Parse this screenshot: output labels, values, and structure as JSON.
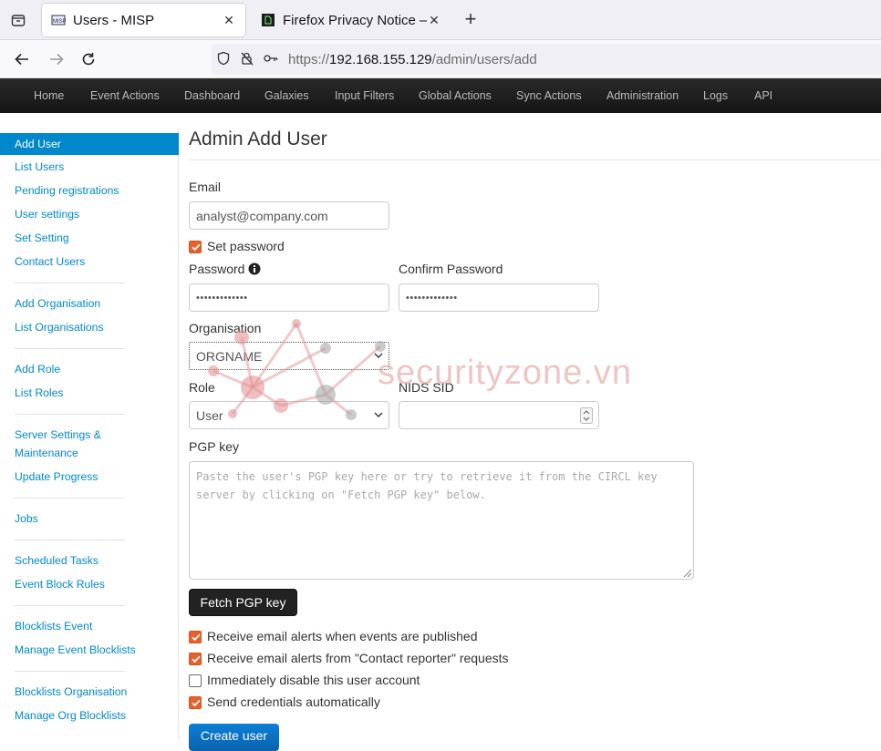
{
  "browser": {
    "tabs": [
      {
        "title": "Users - MISP",
        "active": true
      },
      {
        "title": "Firefox Privacy Notice —",
        "active": false
      }
    ],
    "url_prefix": "https://",
    "url_host": "192.168.155.129",
    "url_path": "/admin/users/add"
  },
  "topnav": [
    "Home",
    "Event Actions",
    "Dashboard",
    "Galaxies",
    "Input Filters",
    "Global Actions",
    "Sync Actions",
    "Administration",
    "Logs",
    "API"
  ],
  "sidebar": {
    "groups": [
      [
        "Add User",
        "List Users",
        "Pending registrations",
        "User settings",
        "Set Setting",
        "Contact Users"
      ],
      [
        "Add Organisation",
        "List Organisations"
      ],
      [
        "Add Role",
        "List Roles"
      ],
      [
        "Server Settings &",
        "Maintenance",
        "Update Progress"
      ],
      [
        "Jobs"
      ],
      [
        "Scheduled Tasks",
        "Event Block Rules"
      ],
      [
        "Blocklists Event",
        "Manage Event Blocklists"
      ],
      [
        "Blocklists Organisation",
        "Manage Org Blocklists"
      ]
    ],
    "active": "Add User"
  },
  "form": {
    "title": "Admin Add User",
    "email_label": "Email",
    "email_value": "analyst@company.com",
    "set_password_label": "Set password",
    "set_password_checked": true,
    "password_label": "Password",
    "password_value": "•••••••••••••",
    "confirm_password_label": "Confirm Password",
    "confirm_password_value": "•••••••••••••",
    "organisation_label": "Organisation",
    "organisation_value": "ORGNAME",
    "role_label": "Role",
    "role_value": "User",
    "nids_label": "NIDS SID",
    "nids_value": "",
    "pgp_label": "PGP key",
    "pgp_placeholder": "Paste the user's PGP key here or try to retrieve it from the CIRCL key server by clicking on \"Fetch PGP key\" below.",
    "fetch_button": "Fetch PGP key",
    "options": [
      {
        "label": "Receive email alerts when events are published",
        "checked": true
      },
      {
        "label": "Receive email alerts from \"Contact reporter\" requests",
        "checked": true
      },
      {
        "label": "Immediately disable this user account",
        "checked": false
      },
      {
        "label": "Send credentials automatically",
        "checked": true
      }
    ],
    "submit_button": "Create user"
  },
  "watermark": "securityzone.vn",
  "colors": {
    "accent": "#0088cc",
    "checkbox": "#e8602c",
    "navbar": "#1b1b1b"
  }
}
